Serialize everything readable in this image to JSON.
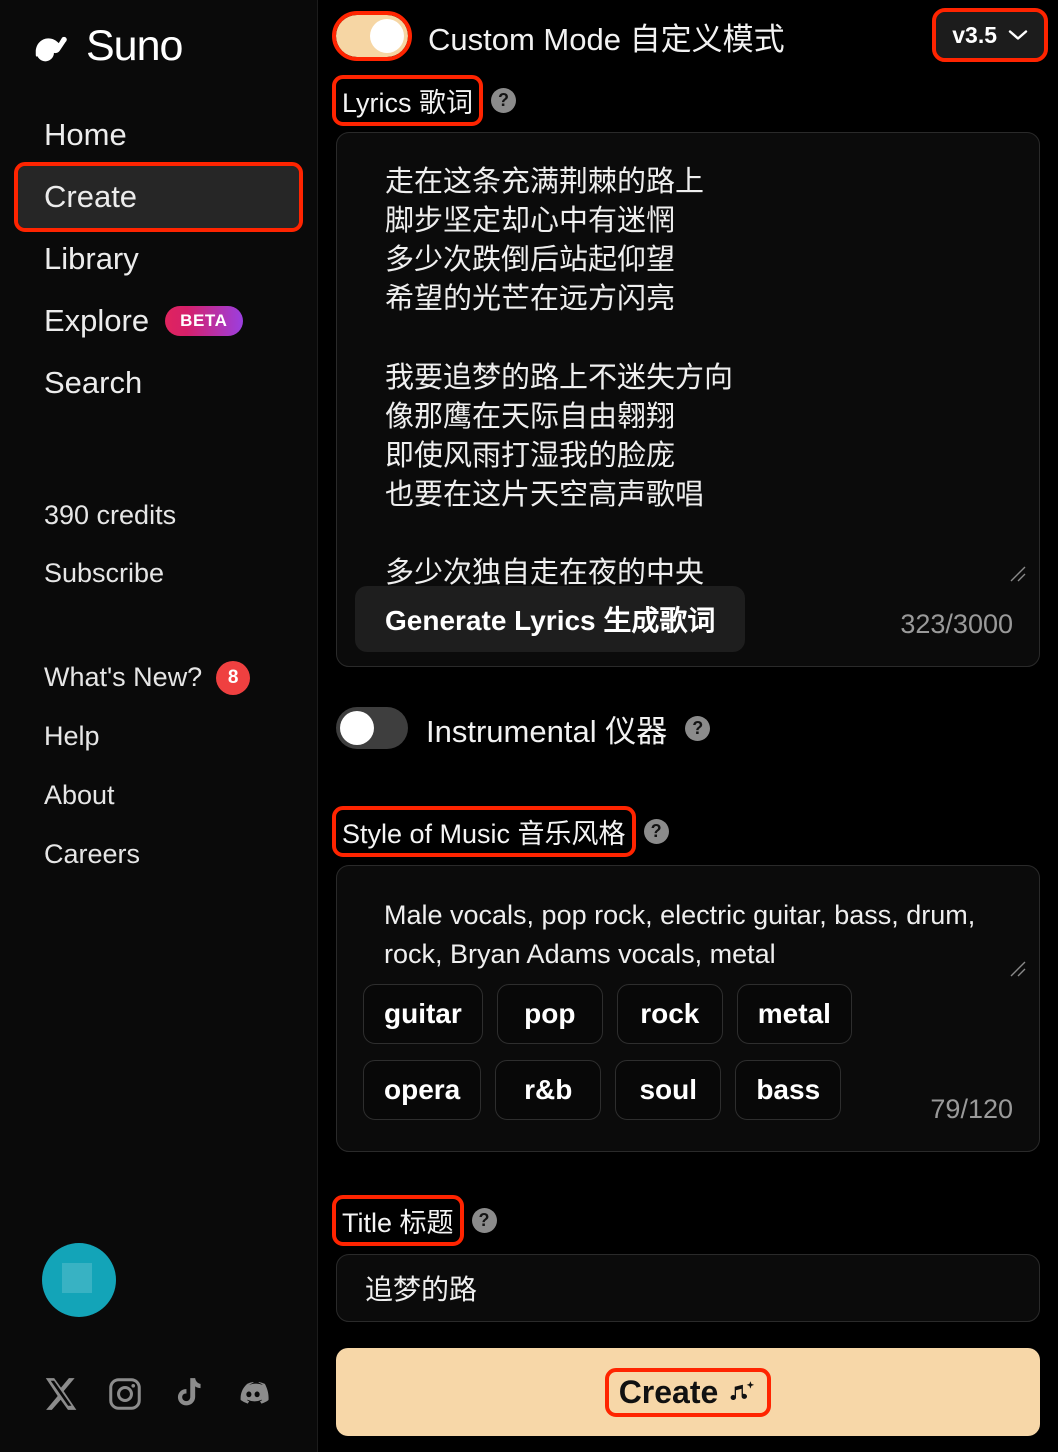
{
  "brand": {
    "name": "Suno",
    "logo_icon": "suno-wave-logo"
  },
  "sidebar": {
    "nav": [
      {
        "label": "Home",
        "active": false
      },
      {
        "label": "Create",
        "active": true
      },
      {
        "label": "Library",
        "active": false
      },
      {
        "label": "Explore",
        "active": false,
        "badge": "BETA"
      },
      {
        "label": "Search",
        "active": false
      }
    ],
    "credits": "390 credits",
    "subscribe": "Subscribe",
    "links": [
      {
        "label": "What's New?",
        "badge": "8"
      },
      {
        "label": "Help"
      },
      {
        "label": "About"
      },
      {
        "label": "Careers"
      }
    ],
    "socials": [
      {
        "name": "x-twitter-icon"
      },
      {
        "name": "instagram-icon"
      },
      {
        "name": "tiktok-icon"
      },
      {
        "name": "discord-icon"
      }
    ],
    "avatar_color": "#13a4b8"
  },
  "main": {
    "custom_mode": {
      "label": "Custom Mode 自定义模式",
      "on": true
    },
    "version": {
      "value": "v3.5",
      "chevron": "chevron-down-icon"
    },
    "lyrics": {
      "label": "Lyrics 歌词",
      "help": "?",
      "value": "走在这条充满荆棘的路上\n脚步坚定却心中有迷惘\n多少次跌倒后站起仰望\n希望的光芒在远方闪亮\n\n我要追梦的路上不迷失方向\n像那鹰在天际自由翱翔\n即使风雨打湿我的脸庞\n也要在这片天空高声歌唱\n\n多少次独自走在夜的中央",
      "generate_button": "Generate Lyrics 生成歌词",
      "counter": "323/3000"
    },
    "instrumental": {
      "label": "Instrumental 仪器",
      "on": false,
      "help": "?"
    },
    "style": {
      "label": "Style of Music 音乐风格",
      "help": "?",
      "value": "Male vocals, pop rock, electric guitar, bass,  drum,  rock,  Bryan Adams vocals,  metal",
      "tags": [
        "guitar",
        "pop",
        "rock",
        "metal",
        "opera",
        "r&b",
        "soul",
        "bass"
      ],
      "counter": "79/120"
    },
    "title": {
      "label": "Title 标题",
      "help": "?",
      "value": "追梦的路"
    },
    "create_button": {
      "label": "Create",
      "icon": "music-note-sparkle-icon"
    }
  },
  "colors": {
    "accent": "#f7d7a8",
    "highlight_outline": "#ff2400",
    "badge_red": "#ef4040",
    "beta_gradient_from": "#e0245e",
    "beta_gradient_to": "#9b3fe0"
  }
}
